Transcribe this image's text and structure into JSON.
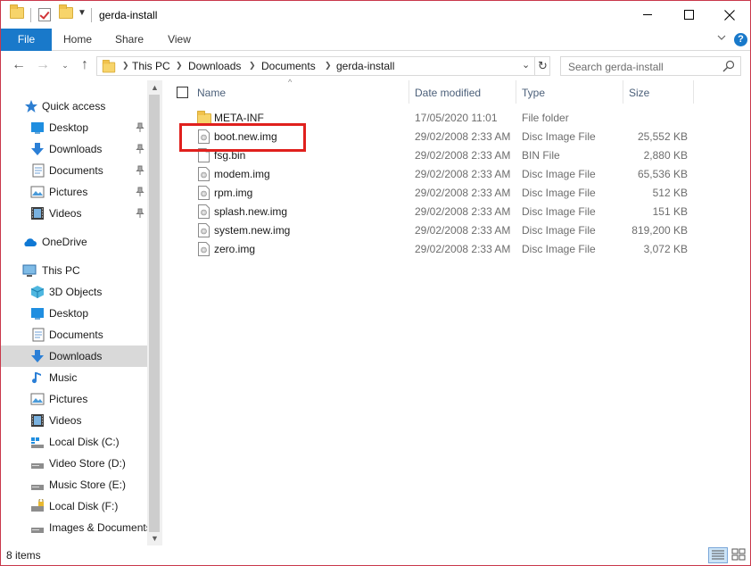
{
  "window": {
    "title": "gerda-install"
  },
  "ribbon": {
    "tabs": [
      "File",
      "Home",
      "Share",
      "View"
    ]
  },
  "address": {
    "crumbs": [
      "This PC",
      "Downloads",
      "Documents",
      "gerda-install"
    ]
  },
  "search": {
    "placeholder": "Search gerda-install"
  },
  "nav": {
    "quick_access": {
      "label": "Quick access",
      "items": [
        {
          "label": "Desktop",
          "icon": "desktop-icon"
        },
        {
          "label": "Downloads",
          "icon": "download-arrow-icon"
        },
        {
          "label": "Documents",
          "icon": "documents-icon"
        },
        {
          "label": "Pictures",
          "icon": "pictures-icon"
        },
        {
          "label": "Videos",
          "icon": "videos-icon"
        }
      ]
    },
    "onedrive": {
      "label": "OneDrive"
    },
    "this_pc": {
      "label": "This PC",
      "items": [
        {
          "label": "3D Objects",
          "icon": "3d-objects-icon"
        },
        {
          "label": "Desktop",
          "icon": "desktop-icon"
        },
        {
          "label": "Documents",
          "icon": "documents-icon"
        },
        {
          "label": "Downloads",
          "icon": "download-arrow-icon",
          "selected": true
        },
        {
          "label": "Music",
          "icon": "music-icon"
        },
        {
          "label": "Pictures",
          "icon": "pictures-icon"
        },
        {
          "label": "Videos",
          "icon": "videos-icon"
        },
        {
          "label": "Local Disk (C:)",
          "icon": "drive-icon"
        },
        {
          "label": "Video Store (D:)",
          "icon": "drive-icon"
        },
        {
          "label": "Music Store (E:)",
          "icon": "drive-icon"
        },
        {
          "label": "Local Disk (F:)",
          "icon": "drive-icon"
        },
        {
          "label": "Images & Documents",
          "icon": "drive-icon"
        }
      ]
    }
  },
  "columns": {
    "name": "Name",
    "date": "Date modified",
    "type": "Type",
    "size": "Size"
  },
  "files": [
    {
      "name": "META-INF",
      "date": "17/05/2020 11:01",
      "type": "File folder",
      "size": "",
      "icon": "folder-icon"
    },
    {
      "name": "boot.new.img",
      "date": "29/02/2008 2:33 AM",
      "type": "Disc Image File",
      "size": "25,552 KB",
      "icon": "disc-image-icon",
      "highlighted": true
    },
    {
      "name": "fsg.bin",
      "date": "29/02/2008 2:33 AM",
      "type": "BIN File",
      "size": "2,880 KB",
      "icon": "file-icon"
    },
    {
      "name": "modem.img",
      "date": "29/02/2008 2:33 AM",
      "type": "Disc Image File",
      "size": "65,536 KB",
      "icon": "disc-image-icon"
    },
    {
      "name": "rpm.img",
      "date": "29/02/2008 2:33 AM",
      "type": "Disc Image File",
      "size": "512 KB",
      "icon": "disc-image-icon"
    },
    {
      "name": "splash.new.img",
      "date": "29/02/2008 2:33 AM",
      "type": "Disc Image File",
      "size": "151 KB",
      "icon": "disc-image-icon"
    },
    {
      "name": "system.new.img",
      "date": "29/02/2008 2:33 AM",
      "type": "Disc Image File",
      "size": "819,200 KB",
      "icon": "disc-image-icon"
    },
    {
      "name": "zero.img",
      "date": "29/02/2008 2:33 AM",
      "type": "Disc Image File",
      "size": "3,072 KB",
      "icon": "disc-image-icon"
    }
  ],
  "status": {
    "item_count": "8 items"
  },
  "colors": {
    "accent": "#1979ca",
    "selection": "#d9d9d9",
    "annotation": "#e0201d",
    "header_text": "#4c607a"
  }
}
